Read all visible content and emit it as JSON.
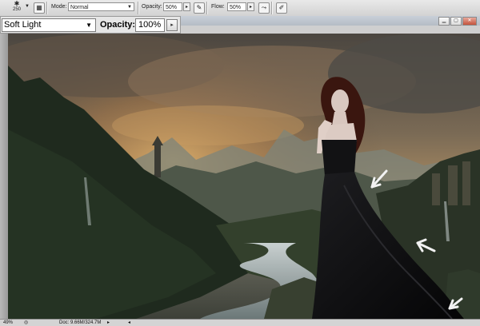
{
  "options_bar": {
    "brush_size": "250",
    "mode_label": "Mode:",
    "mode_value": "Normal",
    "opacity_label": "Opacity:",
    "opacity_value": "50%",
    "flow_label": "Flow:",
    "flow_value": "50%"
  },
  "layer_bar": {
    "blend_mode": "Soft Light",
    "opacity_label": "Opacity:",
    "opacity_value": "100%"
  },
  "status_bar": {
    "zoom": "49%",
    "doc_info": "Doc: 9.66M/324.7M"
  },
  "icons": {
    "brush_preset": "brush-dot-icon",
    "brush_panel": "brush-panel-icon",
    "airbrush": "airbrush-icon",
    "tablet_pressure": "tablet-pressure-icon",
    "minimize": "minimize-icon",
    "maximize": "maximize-icon",
    "close": "close-icon"
  },
  "colors": {
    "sky_top": "#5a544d",
    "sky_glow": "#b98a55",
    "forest": "#1e2a1c",
    "river": "#9aa6aa",
    "gown": "#0d0d0f"
  }
}
